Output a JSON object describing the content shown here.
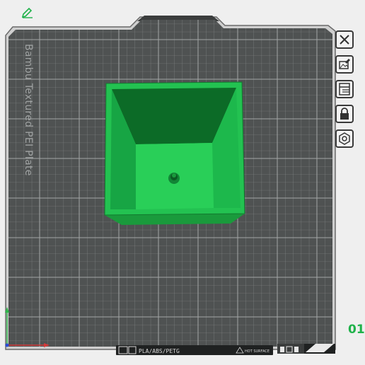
{
  "plate": {
    "name": "Bambu Textured PEI Plate",
    "number": "01",
    "filament_info": "PLA/ABS/PETG",
    "surface_info": "HOT SURFACE"
  },
  "toolbar": {
    "buttons": [
      {
        "name": "close",
        "icon": "close-icon"
      },
      {
        "name": "pick-background",
        "icon": "image-edit-icon"
      },
      {
        "name": "layout",
        "icon": "layout-icon"
      },
      {
        "name": "lock",
        "icon": "lock-icon"
      },
      {
        "name": "settings",
        "icon": "hexagon-nut-icon"
      }
    ],
    "edit_icon": "pencil-icon"
  },
  "colors": {
    "accent": "#1fb24a",
    "plate": "#4f5252",
    "grid": "#878a8a",
    "model_top": "#23c251",
    "model_dark": "#0d7a2c",
    "model_floor": "#28d158"
  }
}
